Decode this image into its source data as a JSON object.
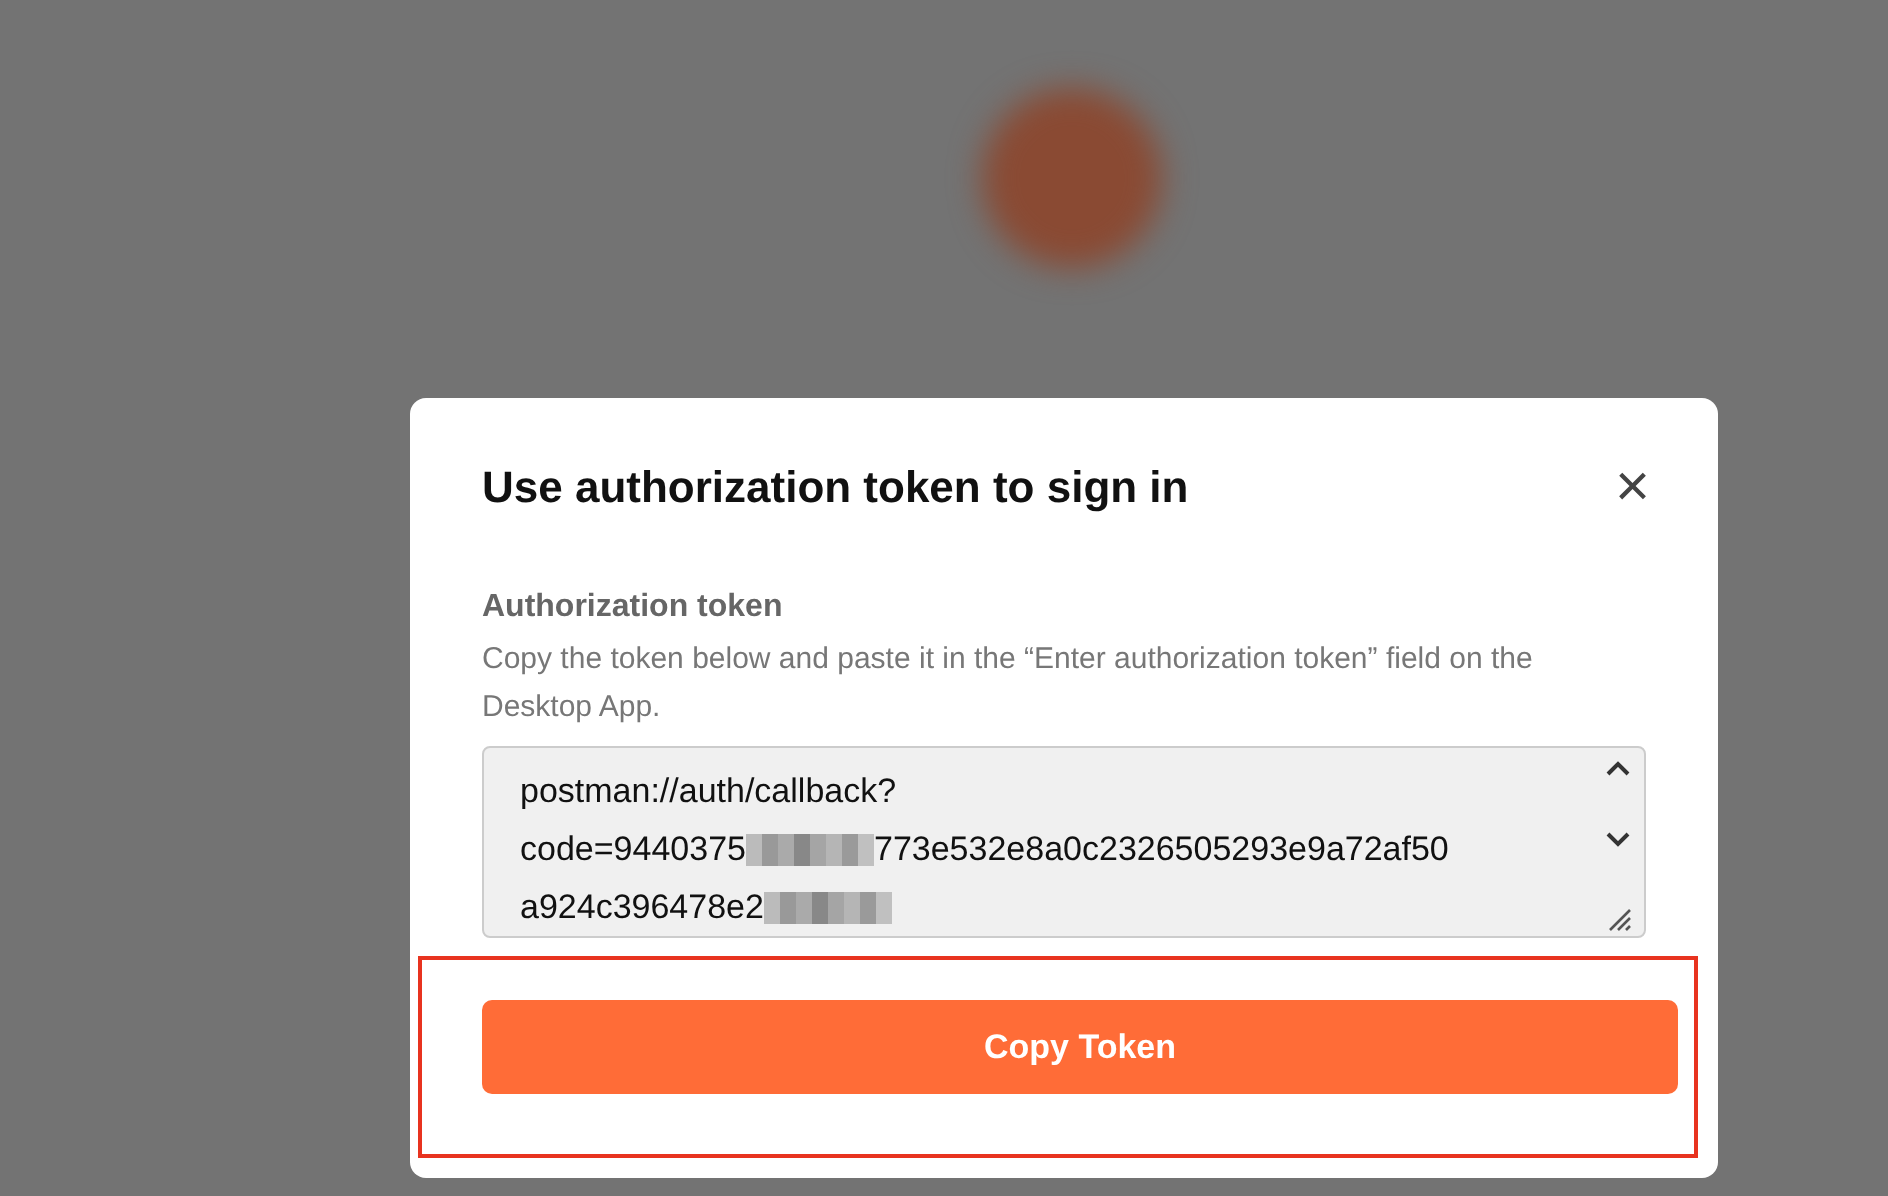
{
  "dialog": {
    "title": "Use authorization token to sign in",
    "close_label": "×",
    "field_label": "Authorization token",
    "help": "Copy the token below and paste it in the “Enter authorization token” field on the Desktop App.",
    "token_lines": [
      [
        {
          "kind": "text",
          "text": "postman://auth/callback?"
        }
      ],
      [
        {
          "kind": "text",
          "text": "code=9440375"
        },
        {
          "kind": "redacted"
        },
        {
          "kind": "text",
          "text": "773e532e8a0c2326505293e9a72af50"
        }
      ],
      [
        {
          "kind": "text",
          "text": "a924c396478e2"
        },
        {
          "kind": "redacted"
        }
      ]
    ],
    "button": "Copy Token"
  }
}
